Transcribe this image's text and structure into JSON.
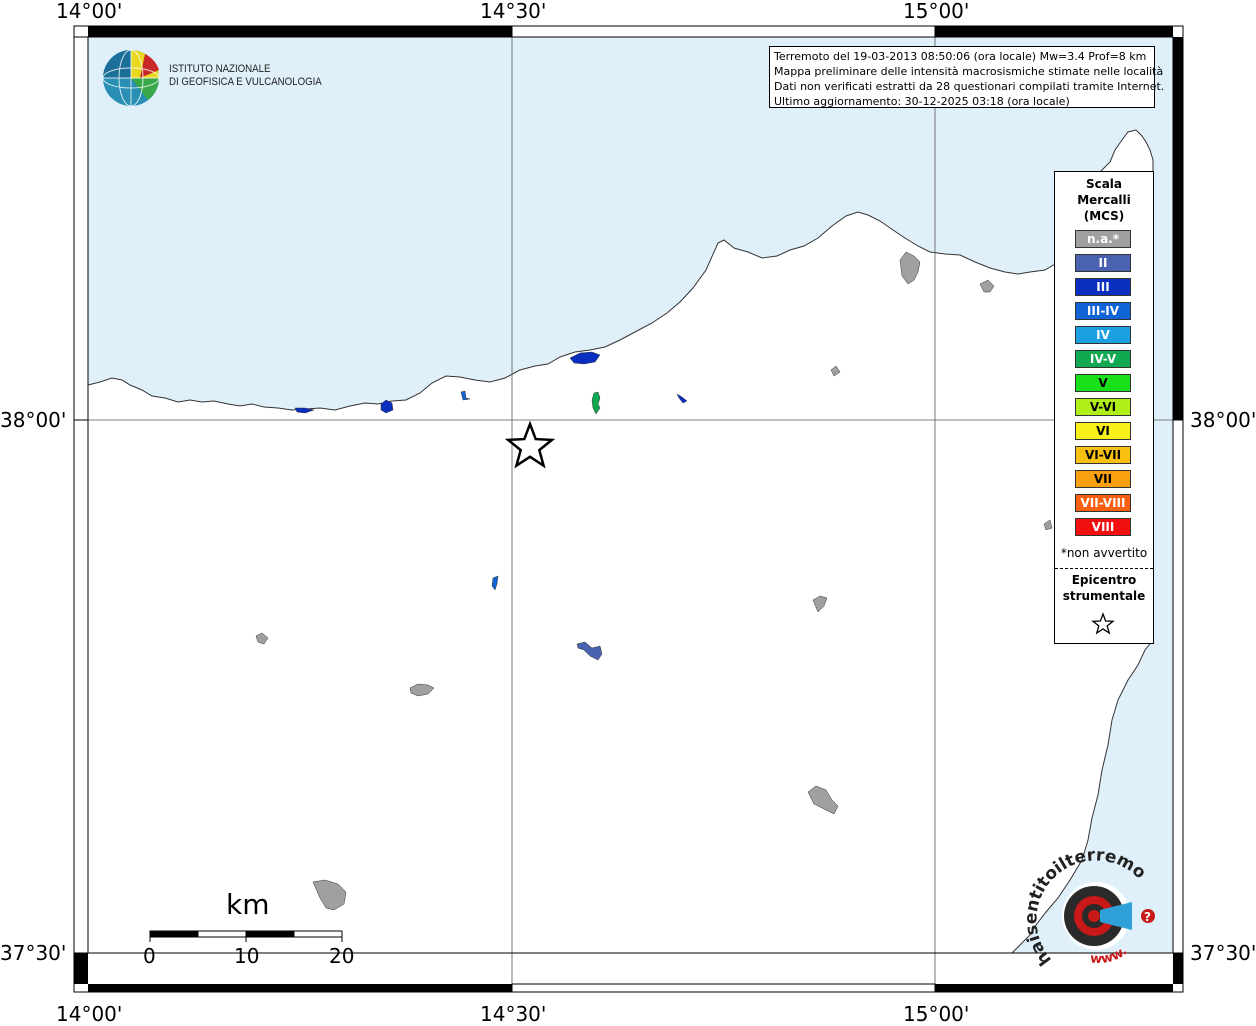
{
  "axes": {
    "top_labels": [
      "14°00'",
      "14°30'",
      "15°00'"
    ],
    "bottom_labels": [
      "14°00'",
      "14°30'",
      "15°00'"
    ],
    "left_labels": [
      "38°00'",
      "37°30'"
    ],
    "right_labels": [
      "38°00'",
      "37°30'"
    ]
  },
  "logo": {
    "line1": "ISTITUTO NAZIONALE",
    "line2": "DI GEOFISICA E VULCANOLOGIA"
  },
  "info": {
    "line1": "Terremoto del 19-03-2013 08:50:06 (ora locale) Mw=3.4 Prof=8 km",
    "line2": "Mappa preliminare delle intensità macrosismiche stimate nelle località",
    "line3": "Dati non verificati estratti da 28 questionari compilati tramite Internet.",
    "line4": "Ultimo aggiornamento: 30-12-2025 03:18 (ora locale)"
  },
  "legend": {
    "title1": "Scala",
    "title2": "Mercalli",
    "title3": "(MCS)",
    "items": [
      {
        "label": "n.a.*",
        "color": "#a0a0a0"
      },
      {
        "label": "II",
        "color": "#4a63b0"
      },
      {
        "label": "III",
        "color": "#0a2ec0"
      },
      {
        "label": "III-IV",
        "color": "#1064d6"
      },
      {
        "label": "IV",
        "color": "#1aa0e0"
      },
      {
        "label": "IV-V",
        "color": "#10a850"
      },
      {
        "label": "V",
        "color": "#18e018"
      },
      {
        "label": "V-VI",
        "color": "#b0f018"
      },
      {
        "label": "VI",
        "color": "#f8f018"
      },
      {
        "label": "VI-VII",
        "color": "#f8c010"
      },
      {
        "label": "VII",
        "color": "#f8a010"
      },
      {
        "label": "VII-VIII",
        "color": "#f86010"
      },
      {
        "label": "VIII",
        "color": "#f01010"
      }
    ],
    "note": "*non avvertito",
    "epi1": "Epicentro",
    "epi2": "strumentale"
  },
  "scale_bar": {
    "unit": "km",
    "labels": [
      "0",
      "10",
      "20"
    ]
  },
  "hsit": {
    "text_main": "haisentitoilterremoto.it",
    "text_www": "www.",
    "q": "?"
  },
  "colors": {
    "sea": "#dff0fb",
    "land": "#ffffff",
    "na": "#a0a0a0"
  }
}
